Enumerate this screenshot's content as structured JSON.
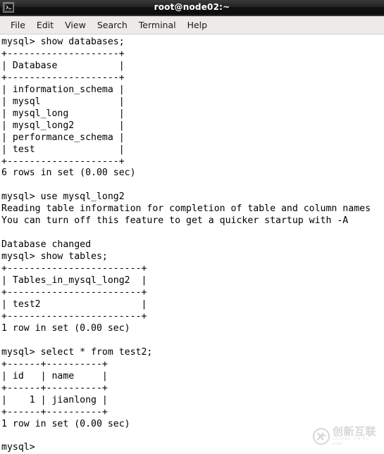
{
  "window": {
    "title": "root@node02:~",
    "icon": "terminal-icon"
  },
  "menubar": {
    "items": [
      {
        "label": "File"
      },
      {
        "label": "Edit"
      },
      {
        "label": "View"
      },
      {
        "label": "Search"
      },
      {
        "label": "Terminal"
      },
      {
        "label": "Help"
      }
    ]
  },
  "terminal": {
    "prompt": "mysql>",
    "lines": [
      "mysql> show databases;",
      "+--------------------+",
      "| Database           |",
      "+--------------------+",
      "| information_schema |",
      "| mysql              |",
      "| mysql_long         |",
      "| mysql_long2        |",
      "| performance_schema |",
      "| test               |",
      "+--------------------+",
      "6 rows in set (0.00 sec)",
      "",
      "mysql> use mysql_long2",
      "Reading table information for completion of table and column names",
      "You can turn off this feature to get a quicker startup with -A",
      "",
      "Database changed",
      "mysql> show tables;",
      "+------------------------+",
      "| Tables_in_mysql_long2  |",
      "+------------------------+",
      "| test2                  |",
      "+------------------------+",
      "1 row in set (0.00 sec)",
      "",
      "mysql> select * from test2;",
      "+------+----------+",
      "| id   | name     |",
      "+------+----------+",
      "|    1 | jianlong |",
      "+------+----------+",
      "1 row in set (0.00 sec)",
      "",
      "mysql>"
    ],
    "commands": [
      "show databases;",
      "use mysql_long2",
      "show tables;",
      "select * from test2;"
    ],
    "databases": [
      "information_schema",
      "mysql",
      "mysql_long",
      "mysql_long2",
      "performance_schema",
      "test"
    ],
    "databases_header": "Database",
    "databases_result": "6 rows in set (0.00 sec)",
    "use_messages": [
      "Reading table information for completion of table and column names",
      "You can turn off this feature to get a quicker startup with -A",
      "Database changed"
    ],
    "tables_header": "Tables_in_mysql_long2",
    "tables": [
      "test2"
    ],
    "tables_result": "1 row in set (0.00 sec)",
    "select_columns": [
      "id",
      "name"
    ],
    "select_rows": [
      {
        "id": "1",
        "name": "jianlong"
      }
    ],
    "select_result": "1 row in set (0.00 sec)",
    "colors": {
      "background": "#ffffff",
      "foreground": "#000000"
    }
  },
  "watermark": {
    "cn": "创新互联",
    "pinyin": "CHUANG XIN HU LIAN"
  }
}
